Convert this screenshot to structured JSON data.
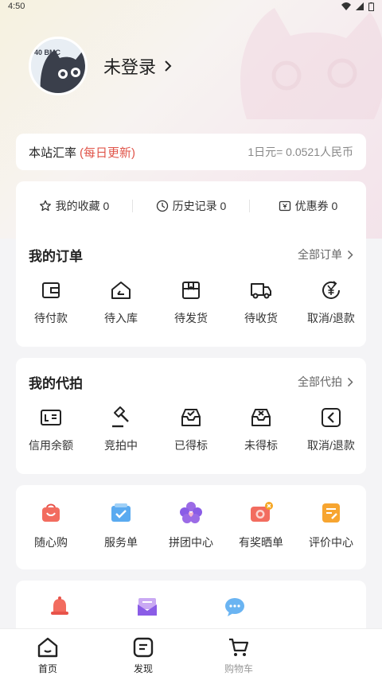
{
  "status": {
    "time": "4:50"
  },
  "profile": {
    "login_label": "未登录",
    "avatar_badge": "40 BMC"
  },
  "rate": {
    "title": "本站汇率",
    "note": "(每日更新)",
    "value": "1日元= 0.0521人民币"
  },
  "quick": [
    {
      "icon": "star-icon",
      "label": "我的收藏 0"
    },
    {
      "icon": "clock-icon",
      "label": "历史记录 0"
    },
    {
      "icon": "coupon-icon",
      "label": "优惠券 0"
    }
  ],
  "orders": {
    "title": "我的订单",
    "more": "全部订单",
    "items": [
      {
        "icon": "wallet-icon",
        "label": "待付款"
      },
      {
        "icon": "warehouse-icon",
        "label": "待入库"
      },
      {
        "icon": "package-icon",
        "label": "待发货"
      },
      {
        "icon": "truck-icon",
        "label": "待收货"
      },
      {
        "icon": "refund-icon",
        "label": "取消/退款"
      }
    ]
  },
  "proxy": {
    "title": "我的代拍",
    "more": "全部代拍",
    "items": [
      {
        "icon": "id-card-icon",
        "label": "信用余额"
      },
      {
        "icon": "gavel-icon",
        "label": "竞拍中"
      },
      {
        "icon": "inbox-check-icon",
        "label": "已得标"
      },
      {
        "icon": "inbox-x-icon",
        "label": "未得标"
      },
      {
        "icon": "return-icon",
        "label": "取消/退款"
      }
    ]
  },
  "services": [
    {
      "icon": "shopping-bag-icon",
      "label": "随心购"
    },
    {
      "icon": "service-check-icon",
      "label": "服务单"
    },
    {
      "icon": "group-heart-icon",
      "label": "拼团中心"
    },
    {
      "icon": "camera-prize-icon",
      "label": "有奖晒单"
    },
    {
      "icon": "review-note-icon",
      "label": "评价中心"
    }
  ],
  "more_icons": [
    "bell-icon",
    "mail-icon",
    "chat-bubble-icon"
  ],
  "tabs": [
    {
      "icon": "home-icon",
      "label": "首页"
    },
    {
      "icon": "discover-icon",
      "label": "发现"
    },
    {
      "icon": "cart-icon",
      "label": "购物车"
    }
  ],
  "colors": {
    "accent_red": "#e0554a",
    "brand_purple": "#8a5ce6",
    "brand_blue": "#4aa0e8",
    "brand_orange": "#f5a623"
  }
}
